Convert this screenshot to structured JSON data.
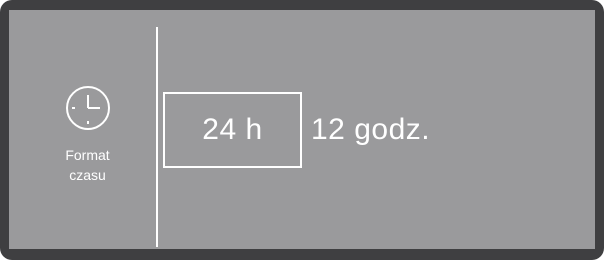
{
  "menu": {
    "icon": "clock-icon",
    "label_line1": "Format",
    "label_line2": "czasu"
  },
  "options": {
    "selected": "24 h",
    "other": "12 godz."
  },
  "colors": {
    "bezel": "#3f3f41",
    "screen": "#9a9a9c",
    "foreground": "#ffffff"
  }
}
